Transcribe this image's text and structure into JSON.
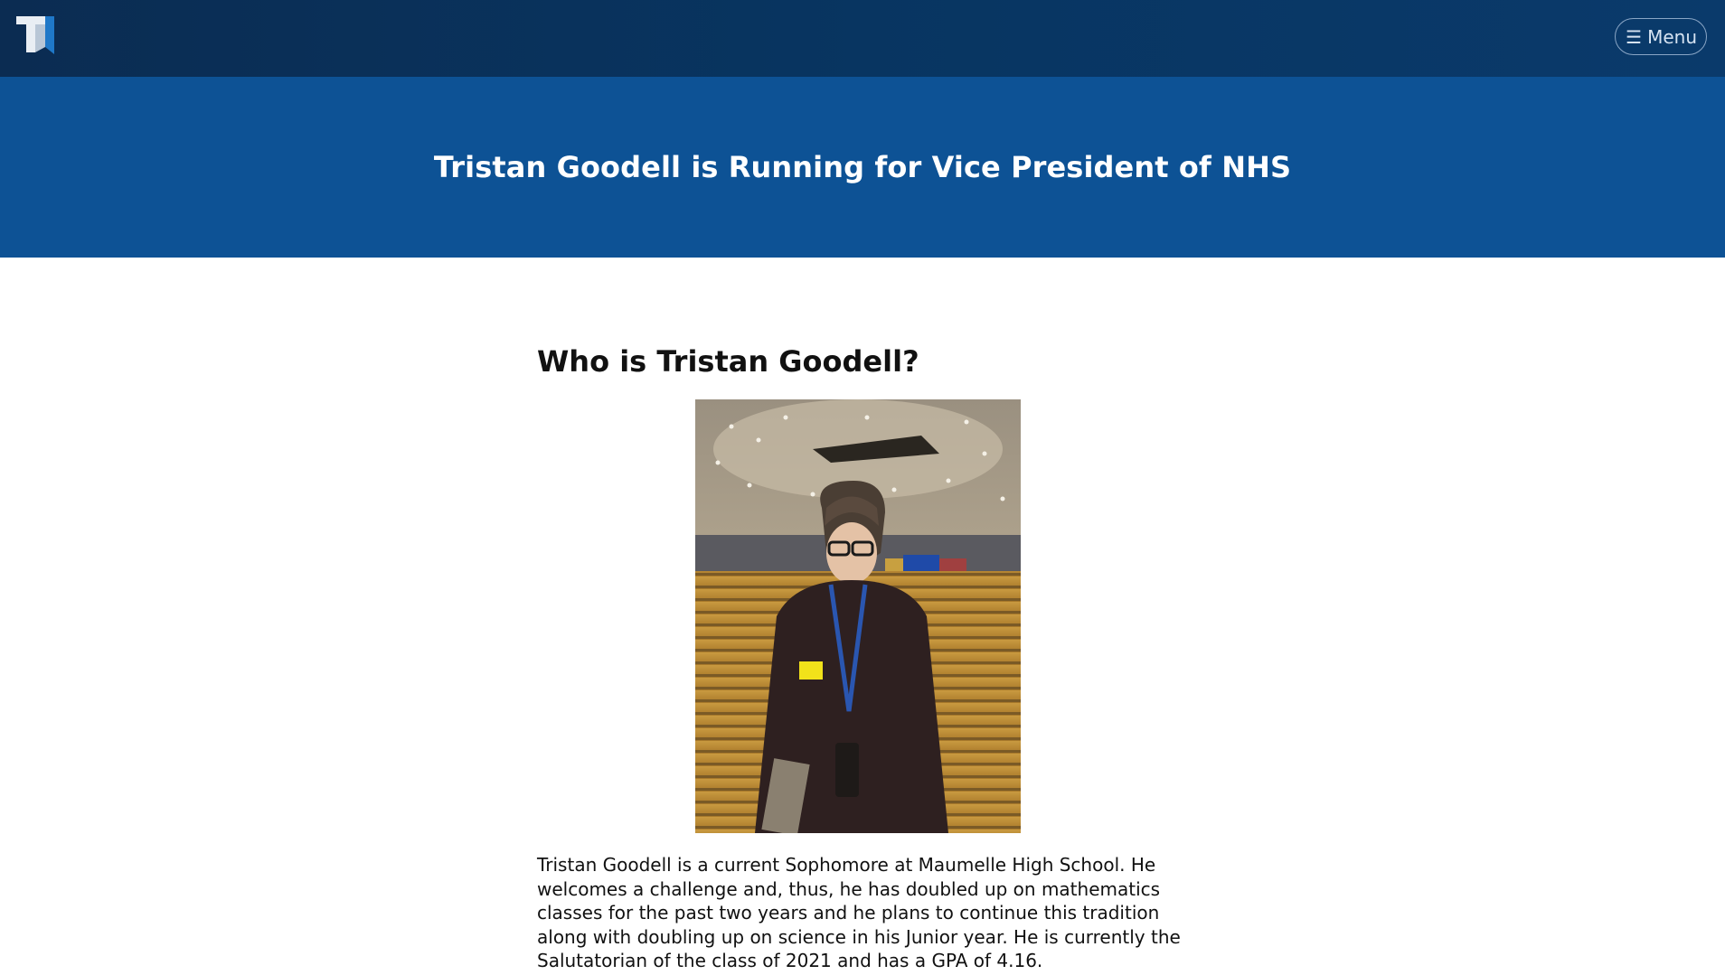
{
  "header": {
    "logo_icon": "t-logo-icon",
    "menu_icon": "hamburger-menu-icon",
    "menu_glyph": "☰",
    "menu_label": "Menu"
  },
  "hero": {
    "title": "Tristan Goodell is Running for Vice President of NHS"
  },
  "main": {
    "heading": "Who is Tristan Goodell?",
    "photo_alt": "Tristan Goodell",
    "bio": "Tristan Goodell is a current Sophomore at Maumelle High School. He welcomes a challenge and, thus, he has doubled up on mathematics classes for the past two years and he plans to continue this tradition along with doubling up on science in his Junior year. He is currently the Salutatorian of the class of 2021 and has a GPA of 4.16."
  },
  "colors": {
    "topbar": "#083561",
    "hero": "#0d5295",
    "text": "#111111"
  }
}
